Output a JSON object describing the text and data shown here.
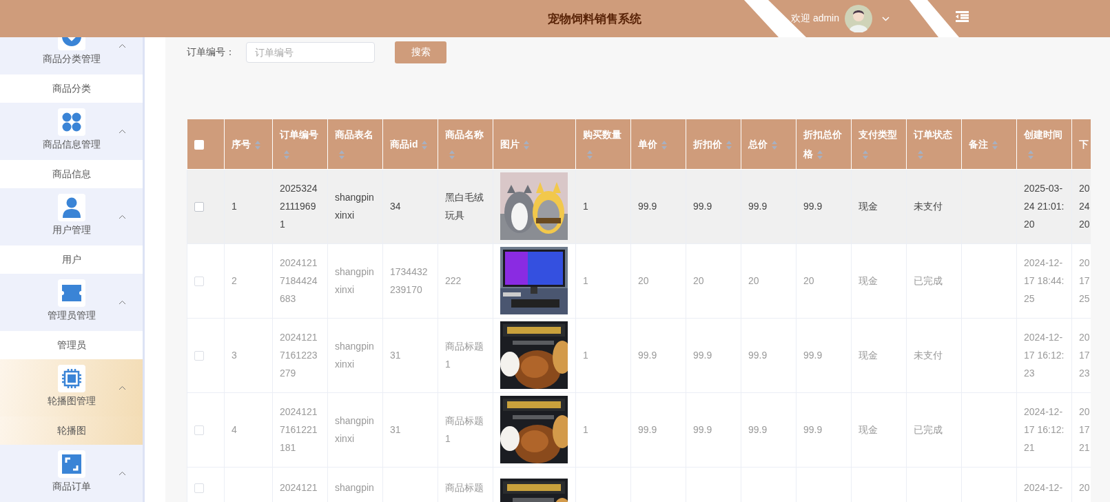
{
  "header": {
    "title": "宠物饲料销售系统",
    "welcome": "欢迎 admin"
  },
  "sidebar": {
    "groups": [
      {
        "label": "商品分类管理",
        "expanded": true,
        "selected": false,
        "children": [
          {
            "label": "商品分类",
            "selected": false
          }
        ]
      },
      {
        "label": "商品信息管理",
        "expanded": true,
        "selected": false,
        "children": [
          {
            "label": "商品信息",
            "selected": false
          }
        ]
      },
      {
        "label": "用户管理",
        "expanded": true,
        "selected": false,
        "children": [
          {
            "label": "用户",
            "selected": false
          }
        ]
      },
      {
        "label": "管理员管理",
        "expanded": true,
        "selected": false,
        "children": [
          {
            "label": "管理员",
            "selected": false
          }
        ]
      },
      {
        "label": "轮播图管理",
        "expanded": true,
        "selected": true,
        "children": [
          {
            "label": "轮播图",
            "selected": true
          }
        ]
      },
      {
        "label": "商品订单",
        "expanded": true,
        "selected": false
      }
    ]
  },
  "search": {
    "label": "订单编号：",
    "placeholder": "订单编号",
    "button": "搜索"
  },
  "table": {
    "select_all": {
      "checked": false
    },
    "columns": [
      {
        "label": "序号",
        "sortable": true
      },
      {
        "label": "订单编号",
        "sortable": true
      },
      {
        "label": "商品表名",
        "sortable": true
      },
      {
        "label": "商品id",
        "sortable": true
      },
      {
        "label": "商品名称",
        "sortable": true
      },
      {
        "label": "图片",
        "sortable": true
      },
      {
        "label": "购买数量",
        "sortable": true
      },
      {
        "label": "单价",
        "sortable": true
      },
      {
        "label": "折扣价",
        "sortable": true
      },
      {
        "label": "总价",
        "sortable": true
      },
      {
        "label": "折扣总价格",
        "sortable": true
      },
      {
        "label": "支付类型",
        "sortable": true
      },
      {
        "label": "订单状态",
        "sortable": true
      },
      {
        "label": "备注",
        "sortable": true
      },
      {
        "label": "创建时间",
        "sortable": true
      },
      {
        "label": "下",
        "sortable": false
      }
    ],
    "rows": [
      {
        "checked": false,
        "hovered": true,
        "index": "1",
        "order_no": "202532421119691",
        "table_name": "shangpinxinxi",
        "product_id": "34",
        "product_name": "黑白毛绒玩具",
        "quantity": "1",
        "unit_price": "99.9",
        "discount_price": "99.9",
        "total": "99.9",
        "discount_total": "99.9",
        "pay_type": "现金",
        "status": "未支付",
        "created": "2025-03-24 21:01:20",
        "column_16": [
          "20",
          "24",
          "20"
        ]
      },
      {
        "checked": false,
        "hovered": false,
        "index": "2",
        "order_no": "20241217184424683",
        "table_name": "shangpinxinxi",
        "product_id": "1734432239170",
        "product_name": "222",
        "quantity": "1",
        "unit_price": "20",
        "discount_price": "20",
        "total": "20",
        "discount_total": "20",
        "pay_type": "现金",
        "status": "已完成",
        "created": "2024-12-17 18:44:25",
        "column_16": [
          "20",
          "17",
          "25"
        ]
      },
      {
        "checked": false,
        "hovered": false,
        "index": "3",
        "order_no": "20241217161223279",
        "table_name": "shangpinxinxi",
        "product_id": "31",
        "product_name": "商品标题1",
        "quantity": "1",
        "unit_price": "99.9",
        "discount_price": "99.9",
        "total": "99.9",
        "discount_total": "99.9",
        "pay_type": "现金",
        "status": "未支付",
        "created": "2024-12-17 16:12:23",
        "column_16": [
          "20",
          "17",
          "23"
        ]
      },
      {
        "checked": false,
        "hovered": false,
        "index": "4",
        "order_no": "20241217161221181",
        "table_name": "shangpinxinxi",
        "product_id": "31",
        "product_name": "商品标题1",
        "quantity": "1",
        "unit_price": "99.9",
        "discount_price": "99.9",
        "total": "99.9",
        "discount_total": "99.9",
        "pay_type": "现金",
        "status": "已完成",
        "created": "2024-12-17 16:12:21",
        "column_16": [
          "20",
          "17",
          "21"
        ]
      },
      {
        "checked": false,
        "hovered": false,
        "order_no": "2024121",
        "table_name": "shangpin",
        "product_name": "商品标题",
        "created": "2024-12-",
        "column_16": [
          "20"
        ]
      }
    ]
  }
}
